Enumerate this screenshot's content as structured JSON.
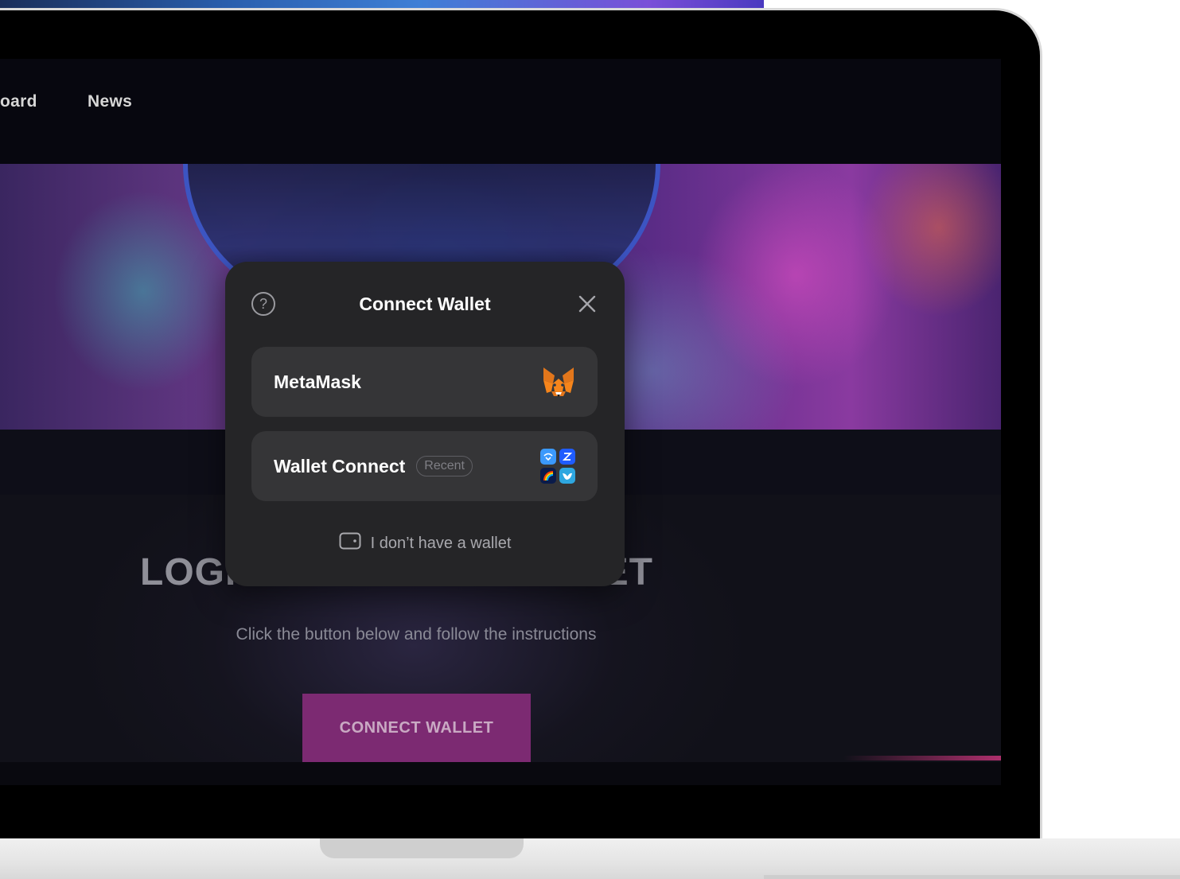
{
  "nav": {
    "items": [
      {
        "label": "oard"
      },
      {
        "label": "News"
      }
    ]
  },
  "hero": {
    "image": "vr-headset-neon-artwork"
  },
  "login": {
    "title_visible_left": "LOGI",
    "title_visible_right": "LET",
    "subtitle": "Click the button below and follow the instructions",
    "button_label": "CONNECT WALLET"
  },
  "modal": {
    "title": "Connect Wallet",
    "help_icon": "question-circle-icon",
    "close_icon": "close-icon",
    "options": [
      {
        "label": "MetaMask",
        "icon": "metamask-fox-icon"
      },
      {
        "label": "Wallet Connect",
        "badge": "Recent",
        "icon": "wallet-connect-grid-icon"
      }
    ],
    "no_wallet_label": "I don’t have a wallet",
    "no_wallet_icon": "wallet-outline-icon"
  },
  "colors": {
    "accent": "#7c2a72",
    "modal_bg": "#252527",
    "option_bg": "#353537",
    "metamask_orange": "#f5841f",
    "wc_blue": "#3b99fc"
  }
}
